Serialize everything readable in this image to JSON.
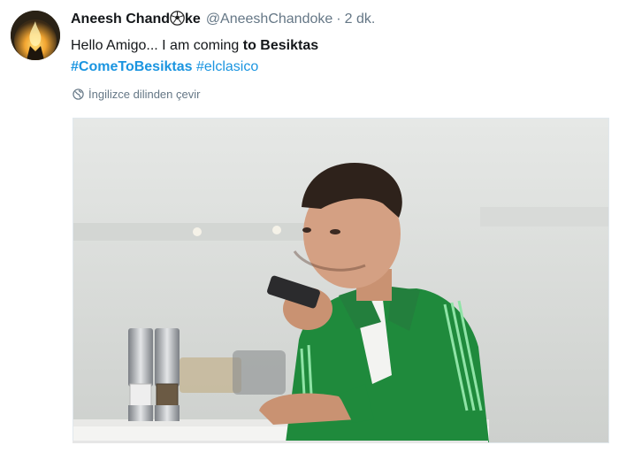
{
  "tweet": {
    "display_name_prefix": "Aneesh Chand",
    "display_name_suffix": "ke",
    "handle": "@AneeshChandoke",
    "separator": "·",
    "time": "2 dk.",
    "text_normal": "Hello Amigo... I am coming ",
    "text_bold": "to Besiktas",
    "hashtag_1": "#ComeToBesiktas",
    "hashtag_2": "#elclasico",
    "translate_label": "İngilizce dilinden çevir"
  },
  "colors": {
    "link": "#1b95e0",
    "muted": "#657786",
    "jacket": "#1f8a3c",
    "stripe": "#8fe3a6"
  },
  "icons": {
    "name_emoji": "soccer-ball-icon",
    "translate": "globe-icon"
  }
}
